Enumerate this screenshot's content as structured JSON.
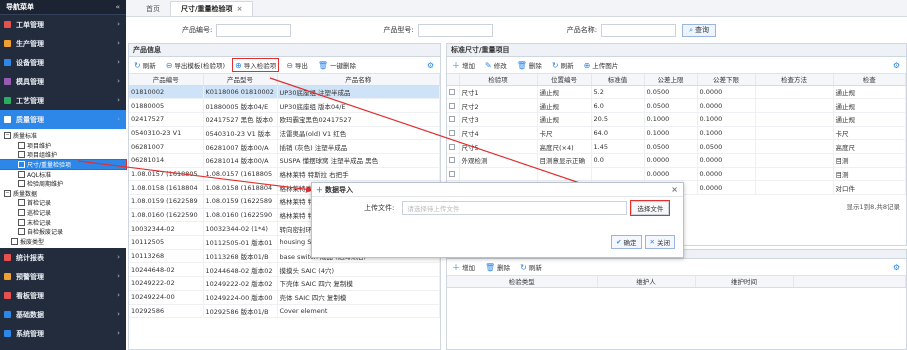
{
  "sidebar": {
    "title": "导航菜单",
    "collapse": "«",
    "menus": [
      {
        "label": "工单管理",
        "color": "#e84f4f"
      },
      {
        "label": "生产管理",
        "color": "#f0a030"
      },
      {
        "label": "设备管理",
        "color": "#2c87e8"
      },
      {
        "label": "模具管理",
        "color": "#9b59b6"
      },
      {
        "label": "工艺管理",
        "color": "#27ae60"
      },
      {
        "label": "质量管理",
        "color": "#ffffff"
      }
    ],
    "tree": [
      {
        "label": "质量标准",
        "type": "folder",
        "indent": 4
      },
      {
        "label": "项目维护",
        "type": "doc",
        "indent": 18
      },
      {
        "label": "项目组维护",
        "type": "doc",
        "indent": 18
      },
      {
        "label": "尺寸/重量检验项",
        "type": "doc",
        "indent": 18,
        "selected": true
      },
      {
        "label": "AQL标准",
        "type": "doc",
        "indent": 18
      },
      {
        "label": "检验周期维护",
        "type": "doc",
        "indent": 18
      },
      {
        "label": "质量数据",
        "type": "folder",
        "indent": 4
      },
      {
        "label": "首检记录",
        "type": "doc",
        "indent": 18
      },
      {
        "label": "巡检记录",
        "type": "doc",
        "indent": 18
      },
      {
        "label": "末检记录",
        "type": "doc",
        "indent": 18
      },
      {
        "label": "自检报废记录",
        "type": "doc",
        "indent": 18
      },
      {
        "label": "报废类型",
        "type": "doc",
        "indent": 11
      }
    ],
    "menus2": [
      {
        "label": "统计报表",
        "color": "#e84f4f"
      },
      {
        "label": "预警管理",
        "color": "#f0a030"
      },
      {
        "label": "看板管理",
        "color": "#e84f4f"
      },
      {
        "label": "基础数据",
        "color": "#2c87e8"
      },
      {
        "label": "系统管理",
        "color": "#2c87e8"
      }
    ]
  },
  "tabs": {
    "home": "首页",
    "current": "尺寸/重量检验项",
    "close": "×"
  },
  "search": {
    "code_label": "产品编号:",
    "model_label": "产品型号:",
    "name_label": "产品名称:",
    "query": "查询"
  },
  "left": {
    "title": "产品信息",
    "toolbar": {
      "refresh": "刷新",
      "export_tpl": "导出模板(检验项)",
      "import": "导入检验项",
      "export": "导出",
      "delete_all": "一键删除"
    },
    "columns": [
      "产品编号",
      "产品型号",
      "产品名称"
    ],
    "rows": [
      [
        "01810002",
        "K0118006 01810002",
        "UP30底座组 注塑半成品"
      ],
      [
        "01880005",
        "01880005 版本04/E",
        "UP30底座组 版本04/E"
      ],
      [
        "02417527",
        "02417527 黑色 版本0",
        "欧玛霸宝黑色02417527"
      ],
      [
        "0540310-23 V1",
        "0540310-23 V1 版本",
        "法雷奥晶(old)  V1 红色"
      ],
      [
        "06281007",
        "06281007 版本00/A",
        "插销 (灰色) 注塑半成品"
      ],
      [
        "06281014",
        "06281014 版本00/A",
        "SUSPA 懂摆球窝 注塑半成品 黑色"
      ],
      [
        "1.08.0157 (1618805",
        "1.08.0157 (1618805",
        "格林莱特 特斯拉 右把手"
      ],
      [
        "1.08.0158 (1618804",
        "1.08.0158 (1618804",
        "格林莱特 特斯拉 右把手"
      ],
      [
        "1.08.0159 (1622589",
        "1.08.0159 (1622589",
        "格林莱特 特斯拉 右把手"
      ],
      [
        "1.08.0160 (1622590",
        "1.08.0160 (1622590",
        "格林莱特 特斯拉 右把手"
      ],
      [
        "10032344-02",
        "10032344-02 (1*4)",
        "转向密封环 (1*4) 专供"
      ],
      [
        "10112505",
        "10112505-01 版本01",
        "housing SW CHB041"
      ],
      [
        "10113268",
        "10113268 版本01/B",
        "base switch 成品 (贴海绵后)"
      ],
      [
        "10244648-02",
        "10244648-02 版本02",
        "摸摸头 SAIC (4穴)"
      ],
      [
        "10249222-02",
        "10249222-02 版本02",
        "下壳体 SAIC 四穴 复制模"
      ],
      [
        "10249224-00",
        "10249224-00 版本00",
        "壳体 SAIC 四穴 复制模"
      ],
      [
        "10292586",
        "10292586 版本01/B",
        "Cover element"
      ]
    ]
  },
  "right": {
    "title": "标准尺寸/重量项目",
    "toolbar": {
      "add": "增加",
      "edit": "修改",
      "delete": "删除",
      "refresh": "刷新",
      "upload": "上传图片"
    },
    "columns": [
      "检验项",
      "位置编号",
      "标准值",
      "公差上限",
      "公差下限",
      "检查方法",
      "检查"
    ],
    "rows": [
      [
        "尺寸1",
        "通止规",
        "5.2",
        "0.0500",
        "0.0000",
        "",
        "通止规"
      ],
      [
        "尺寸2",
        "通止规",
        "6.0",
        "0.0500",
        "0.0000",
        "",
        "通止规"
      ],
      [
        "尺寸3",
        "通止规",
        "20.5",
        "0.1000",
        "0.1000",
        "",
        "通止规"
      ],
      [
        "尺寸4",
        "卡尺",
        "64.0",
        "0.1000",
        "0.1000",
        "",
        "卡尺"
      ],
      [
        "尺寸5",
        "高度尺(×4)",
        "1.45",
        "0.0500",
        "0.0500",
        "",
        "高度尺"
      ],
      [
        "外观检测",
        "目测意显示正确",
        "0.0",
        "0.0000",
        "0.0000",
        "",
        "目测"
      ],
      [
        "",
        "",
        "",
        "0.0000",
        "0.0000",
        "",
        "目测"
      ],
      [
        "",
        "",
        "",
        "0.0000",
        "0.0000",
        "",
        "对口件"
      ]
    ],
    "footer": "显示1到8,共8记录",
    "sub_title": "检验类型",
    "sub_toolbar": {
      "add": "增加",
      "delete": "删除",
      "refresh": "刷新"
    },
    "sub_columns": [
      "检验类型",
      "维护人",
      "维护时间"
    ]
  },
  "dialog": {
    "title": "数据导入",
    "file_label": "上传文件:",
    "placeholder": "请选择待上传文件",
    "choose": "选择文件",
    "ok": "确定",
    "close": "关闭",
    "x": "×"
  },
  "accent": "#2c87e8",
  "annotation": "#e03030"
}
